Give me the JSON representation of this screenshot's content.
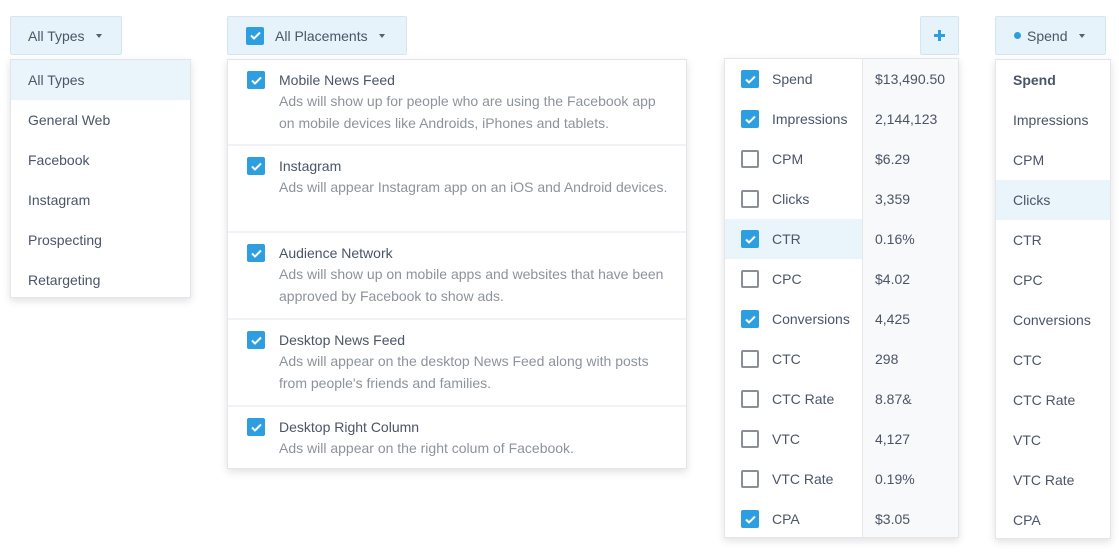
{
  "types_dropdown": {
    "label": "All Types",
    "options": [
      "All Types",
      "General Web",
      "Facebook",
      "Instagram",
      "Prospecting",
      "Retargeting"
    ],
    "highlighted": "All Types"
  },
  "placements_dropdown": {
    "label": "All Placements",
    "checked": true,
    "options": [
      {
        "title": "Mobile News Feed",
        "description": "Ads will show up for people who are using the Facebook app on mobile devices like Androids, iPhones and tablets.",
        "checked": true
      },
      {
        "title": "Instagram",
        "description": "Ads will appear Instagram app on an iOS and Android devices.",
        "checked": true
      },
      {
        "title": "Audience Network",
        "description": "Ads will show up on mobile apps and websites that have been approved by Facebook to show ads.",
        "checked": true
      },
      {
        "title": "Desktop News Feed",
        "description": "Ads will appear on the desktop News Feed along with posts from people's friends and families.",
        "checked": true
      },
      {
        "title": "Desktop Right Column",
        "description": "Ads will appear on the right colum of Facebook.",
        "checked": true
      }
    ]
  },
  "add_button": {
    "icon": "plus-icon",
    "label": "+"
  },
  "metrics_panel": {
    "rows": [
      {
        "label": "Spend",
        "value": "$13,490.50",
        "checked": true
      },
      {
        "label": "Impressions",
        "value": "2,144,123",
        "checked": true
      },
      {
        "label": "CPM",
        "value": "$6.29",
        "checked": false
      },
      {
        "label": "Clicks",
        "value": "3,359",
        "checked": false
      },
      {
        "label": "CTR",
        "value": "0.16%",
        "checked": true,
        "highlighted": true
      },
      {
        "label": "CPC",
        "value": "$4.02",
        "checked": false
      },
      {
        "label": "Conversions",
        "value": "4,425",
        "checked": true
      },
      {
        "label": "CTC",
        "value": "298",
        "checked": false
      },
      {
        "label": "CTC Rate",
        "value": "8.87&",
        "checked": false
      },
      {
        "label": "VTC",
        "value": "4,127",
        "checked": false
      },
      {
        "label": "VTC Rate",
        "value": "0.19%",
        "checked": false
      },
      {
        "label": "CPA",
        "value": "$3.05",
        "checked": true
      }
    ]
  },
  "metric_selector": {
    "label": "Spend",
    "selected": "Spend",
    "hovered": "Clicks",
    "accent_color": "#2d9ee0",
    "options": [
      "Spend",
      "Impressions",
      "CPM",
      "Clicks",
      "CTR",
      "CPC",
      "Conversions",
      "CTC",
      "CTC Rate",
      "VTC",
      "VTC Rate",
      "CPA"
    ]
  }
}
